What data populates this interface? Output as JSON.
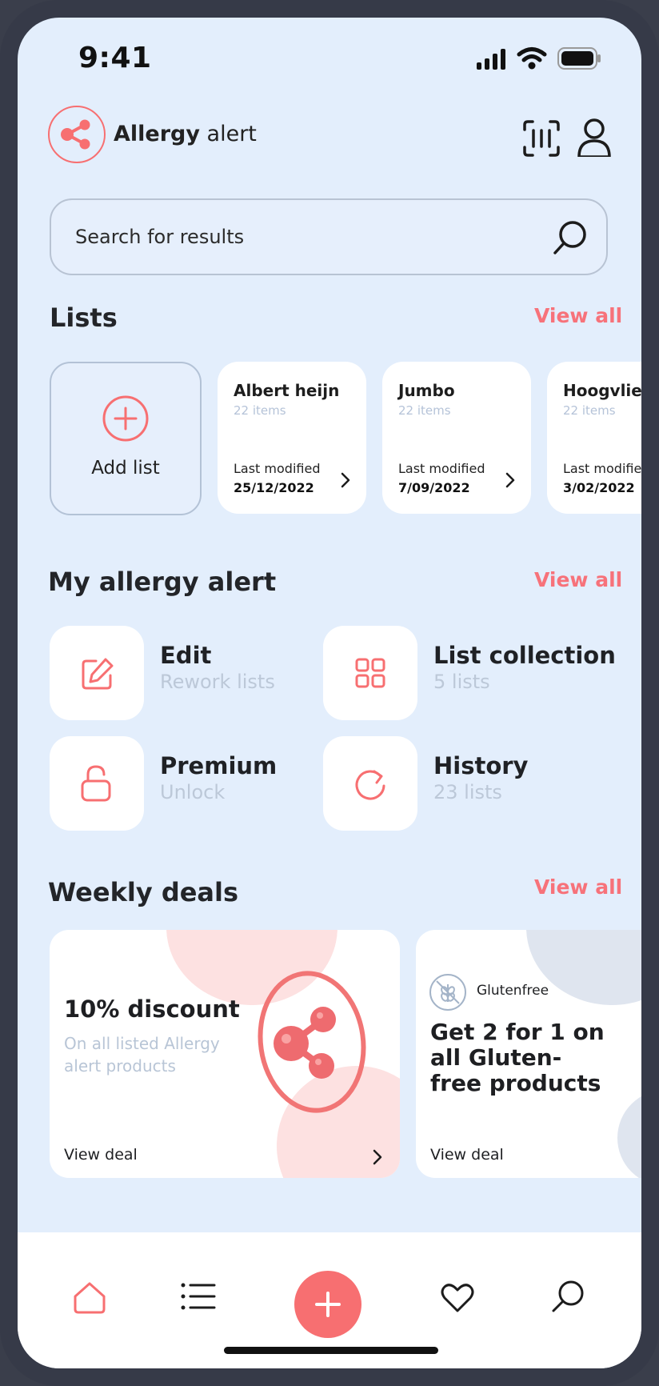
{
  "status_bar": {
    "time": "9:41"
  },
  "header": {
    "app_name_bold": "Allergy",
    "app_name_rest": " alert"
  },
  "search": {
    "placeholder": "Search for results"
  },
  "lists": {
    "title": "Lists",
    "view_all": "View all",
    "add_label": "Add list",
    "items": [
      {
        "name": "Albert heijn",
        "count": "22 items",
        "modified_label": "Last modified",
        "date": "25/12/2022"
      },
      {
        "name": "Jumbo",
        "count": "22 items",
        "modified_label": "Last modified",
        "date": "7/09/2022"
      },
      {
        "name": "Hoogvliet",
        "count": "22 items",
        "modified_label": "Last modified",
        "date": "3/02/2022"
      }
    ]
  },
  "my_alert": {
    "title": "My allergy alert",
    "view_all": "View all",
    "tiles": [
      {
        "title": "Edit",
        "sub": "Rework lists",
        "icon": "edit-icon"
      },
      {
        "title": "List collection",
        "sub": "5 lists",
        "icon": "grid-icon"
      },
      {
        "title": "Premium",
        "sub": "Unlock",
        "icon": "unlock-icon"
      },
      {
        "title": "History",
        "sub": "23 lists",
        "icon": "refresh-icon"
      }
    ]
  },
  "deals": {
    "title": "Weekly deals",
    "view_all": "View all",
    "items": [
      {
        "headline": "10% discount",
        "sub": "On all listed Allergy alert products",
        "cta": "View deal"
      },
      {
        "badge": "Glutenfree",
        "headline": "Get 2 for 1 on all Gluten-free products",
        "cta": "View deal"
      }
    ]
  },
  "colors": {
    "accent": "#f76f71",
    "background": "#e3eefc",
    "muted": "#b5c3d8"
  }
}
